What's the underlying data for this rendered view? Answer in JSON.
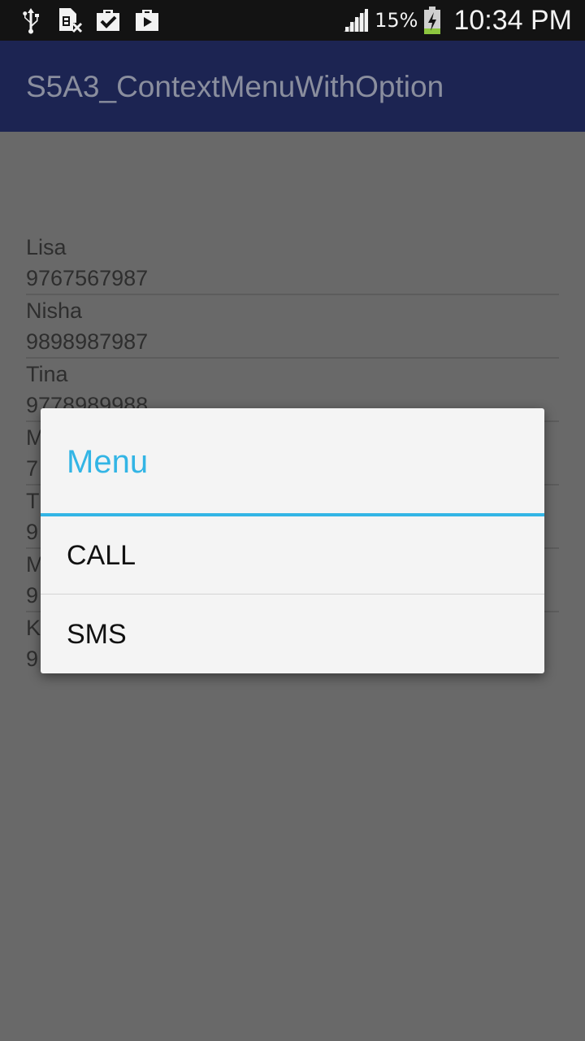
{
  "status_bar": {
    "icons": [
      "usb-icon",
      "no-sim-icon",
      "clipboard-check-icon",
      "media-icon",
      "signal-icon",
      "battery-charging-icon"
    ],
    "battery_percent": "15%",
    "time": "10:34 PM"
  },
  "action_bar": {
    "title": "S5A3_ContextMenuWithOption"
  },
  "contacts": [
    {
      "name": "Lisa",
      "phone": "9767567987"
    },
    {
      "name": "Nisha",
      "phone": "9898987987"
    },
    {
      "name": "Tina",
      "phone": "9778989988"
    },
    {
      "name": "M",
      "phone": "7"
    },
    {
      "name": "T",
      "phone": "9"
    },
    {
      "name": "M",
      "phone": "9"
    },
    {
      "name": "K",
      "phone": "9"
    }
  ],
  "dialog": {
    "title": "Menu",
    "items": [
      {
        "label": "CALL"
      },
      {
        "label": "SMS"
      }
    ]
  },
  "colors": {
    "accent": "#33b5e5",
    "action_bar": "#1c2452",
    "overlay_background": "#696969"
  }
}
